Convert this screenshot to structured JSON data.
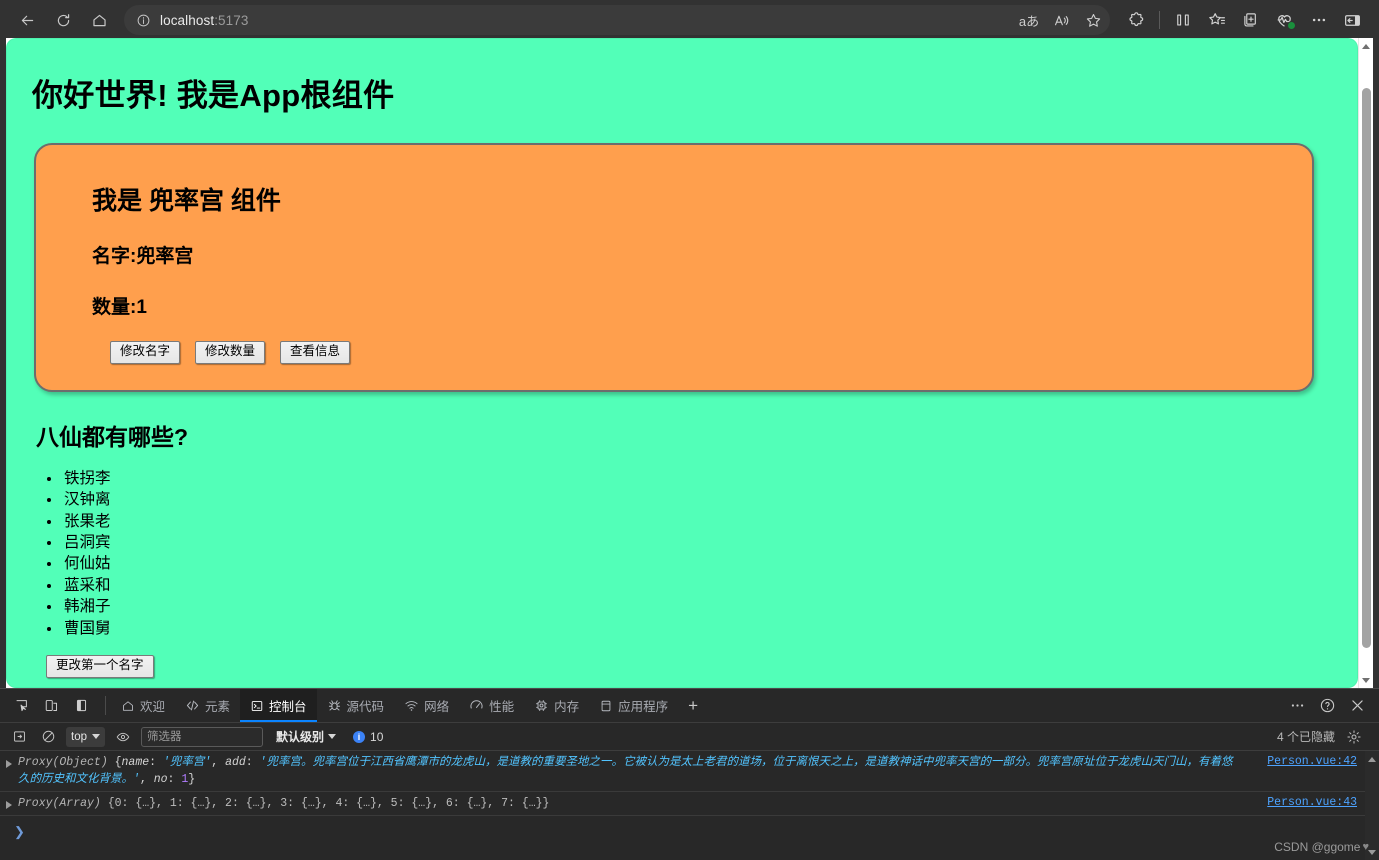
{
  "browser": {
    "nav": {
      "back": "back-arrow",
      "refresh": "refresh",
      "home": "home"
    },
    "address": {
      "host": "localhost",
      "port": ":5173",
      "info_icon": "info-circle"
    },
    "address_actions": [
      "read-aloud-translate-icon",
      "read-aloud-icon",
      "favorite-star-icon"
    ],
    "toolbar_icons": [
      "extensions-icon",
      "split-screen-icon",
      "collections-star-icon",
      "add-tab-group-icon",
      "browser-essentials-icon",
      "more-options-icon",
      "sidebar-toggle-icon"
    ]
  },
  "page": {
    "bg_color": "#52ffb8",
    "title": "你好世界! 我是App根组件",
    "card": {
      "bg_color": "#ff9f4d",
      "heading": "我是 兜率宫 组件",
      "name_line": "名字:兜率宫",
      "count_line": "数量:1",
      "buttons": [
        "修改名字",
        "修改数量",
        "查看信息"
      ]
    },
    "list_section": {
      "heading": "八仙都有哪些?",
      "items": [
        "铁拐李",
        "汉钟离",
        "张果老",
        "吕洞宾",
        "何仙姑",
        "蓝采和",
        "韩湘子",
        "曹国舅"
      ],
      "button": "更改第一个名字"
    }
  },
  "devtools": {
    "left_icons": [
      "inspect-element-icon",
      "device-toolbar-icon",
      "dock-side-icon"
    ],
    "tabs": [
      {
        "label": "欢迎",
        "icon": "home-icon",
        "active": false
      },
      {
        "label": "元素",
        "icon": "code-brackets-icon",
        "active": false
      },
      {
        "label": "控制台",
        "icon": "console-icon",
        "active": true
      },
      {
        "label": "源代码",
        "icon": "sources-bug-icon",
        "active": false
      },
      {
        "label": "网络",
        "icon": "network-wifi-icon",
        "active": false
      },
      {
        "label": "性能",
        "icon": "performance-gauge-icon",
        "active": false
      },
      {
        "label": "内存",
        "icon": "memory-chip-icon",
        "active": false
      },
      {
        "label": "应用程序",
        "icon": "application-storage-icon",
        "active": false
      }
    ],
    "add_tab": "+",
    "right_buttons": [
      "more-tools-icon",
      "help-icon",
      "close-devtools-icon"
    ],
    "console_toolbar": {
      "clear_console_icon": "clear-console-icon",
      "no_entry_icon": "no-entry-icon",
      "context": "top",
      "eye_icon": "live-expression-icon",
      "filter_placeholder": "筛选器",
      "filter_value": "",
      "level": "默认级别",
      "info_count": "10",
      "hidden_text": "4 个已隐藏",
      "settings_icon": "settings-gear-icon"
    },
    "messages": [
      {
        "type": "Proxy(Object)",
        "body_open": " {",
        "k1": "name",
        "v1": "'兜率宫'",
        "k2": "add",
        "v2": "'兜率宫。兜率宫位于江西省鹰潭市的龙虎山，是道教的重要圣地之一。它被认为是太上老君的道场，位于离恨天之上，是道教神话中兜率天宫的一部分。兜率宫原址位于龙虎山天门山，有着悠久的历史和文化背景。'",
        "k3": "no",
        "v3": "1",
        "body_close": "}",
        "source": "Person.vue:42"
      },
      {
        "type": "Proxy(Array)",
        "text": " {0: {…}, 1: {…}, 2: {…}, 3: {…}, 4: {…}, 5: {…}, 6: {…}, 7: {…}}",
        "source": "Person.vue:43"
      }
    ],
    "prompt_caret": "❯"
  },
  "watermark": {
    "text": "CSDN @ggome",
    "heart": "♥"
  }
}
